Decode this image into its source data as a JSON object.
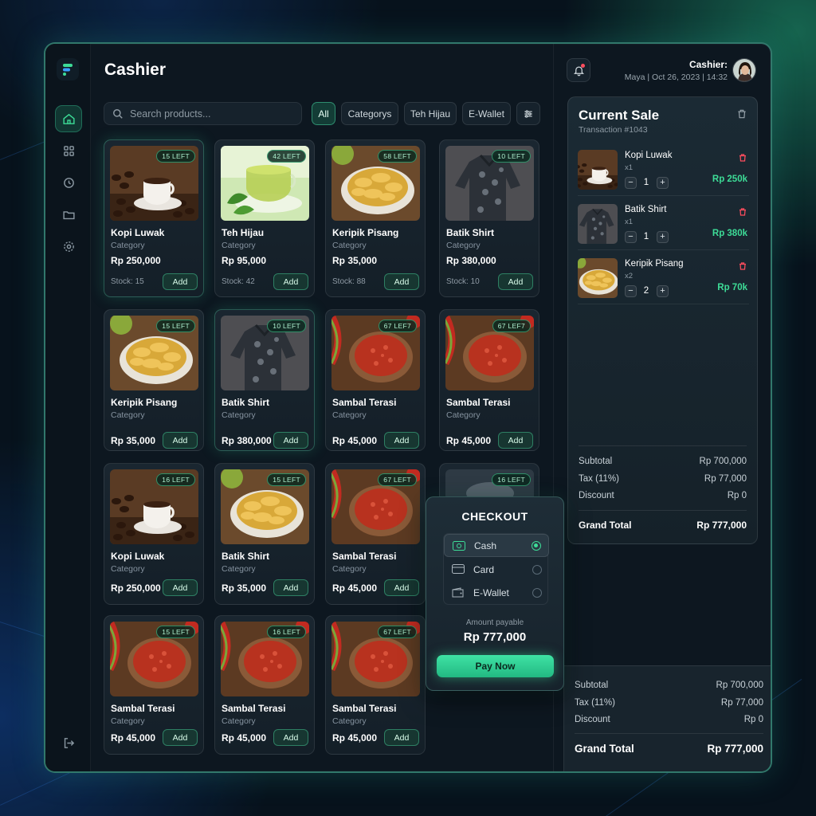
{
  "app": {
    "title": "Cashier"
  },
  "search": {
    "placeholder": "Search products..."
  },
  "filters": [
    "All",
    "Categorys",
    "Teh Hijau",
    "E-Wallet"
  ],
  "header": {
    "cashier_label": "Cashier:",
    "meta": "Maya | Oct 26, 2023 | 14:32"
  },
  "products": [
    {
      "name": "Kopi Luwak",
      "category": "Category",
      "price": "Rp 250,000",
      "badge": "15 LEFT",
      "stock": "Stock: 15",
      "img": "coffee"
    },
    {
      "name": "Teh Hijau",
      "category": "Category",
      "price": "Rp 95,000",
      "badge": "42 LEFT",
      "stock": "Stock: 42",
      "img": "tea"
    },
    {
      "name": "Keripik Pisang",
      "category": "Category",
      "price": "Rp 35,000",
      "badge": "58 LEFT",
      "stock": "Stock: 88",
      "img": "chips"
    },
    {
      "name": "Batik Shirt",
      "category": "Category",
      "price": "Rp 380,000",
      "badge": "10 LEFT",
      "stock": "Stock: 10",
      "img": "shirt"
    },
    {
      "name": "Keripik Pisang",
      "category": "Category",
      "price": "Rp 35,000",
      "badge": "15 LEFT",
      "img": "chips"
    },
    {
      "name": "Batik Shirt",
      "category": "Category",
      "price": "Rp 380,000",
      "badge": "10 LEFT",
      "img": "shirt"
    },
    {
      "name": "Sambal Terasi",
      "category": "Category",
      "price": "Rp 45,000",
      "badge": "67 LEF7",
      "img": "sambal"
    },
    {
      "name": "Sambal Terasi",
      "category": "Category",
      "price": "Rp 45,000",
      "badge": "67 LEF7",
      "img": "sambal"
    },
    {
      "name": "Kopi Luwak",
      "category": "Category",
      "price": "Rp 250,000",
      "badge": "16 LEFT",
      "img": "coffee"
    },
    {
      "name": "Batik Shirt",
      "category": "Category",
      "price": "Rp 35,000",
      "badge": "15 LEFT",
      "img": "chips"
    },
    {
      "name": "Sambal Terasi",
      "category": "Category",
      "price": "Rp 45,000",
      "badge": "67 LEFT",
      "img": "sambal"
    },
    {
      "name": "",
      "category": "",
      "price": "",
      "badge": "16 LEFT",
      "img": "pot"
    },
    {
      "name": "Sambal Terasi",
      "category": "Category",
      "price": "Rp 45,000",
      "badge": "15 LEFT",
      "img": "sambal"
    },
    {
      "name": "Sambal Terasi",
      "category": "Category",
      "price": "Rp 45,000",
      "badge": "16 LEFT",
      "img": "sambal"
    },
    {
      "name": "Sambal Terasi",
      "category": "Category",
      "price": "Rp 45,000",
      "badge": "67 LEFT",
      "img": "sambal"
    }
  ],
  "add_label": "Add",
  "sale": {
    "title": "Current Sale",
    "transaction": "Transaction #1043",
    "items": [
      {
        "name": "Kopi Luwak",
        "qty_label": "x1",
        "qty": "1",
        "price": "Rp 250k",
        "img": "coffee"
      },
      {
        "name": "Batik Shirt",
        "qty_label": "x1",
        "qty": "1",
        "price": "Rp 380k",
        "img": "shirt"
      },
      {
        "name": "Keripik Pisang",
        "qty_label": "x2",
        "qty": "2",
        "price": "Rp 70k",
        "img": "chips"
      }
    ],
    "subtotal_label": "Subtotal",
    "subtotal": "Rp 700,000",
    "tax_label": "Tax (11%)",
    "tax": "Rp 77,000",
    "discount_label": "Discount",
    "discount": "Rp 0",
    "grand_label": "Grand Total",
    "grand": "Rp 777,000"
  },
  "bottom": {
    "subtotal_label": "Subtotal",
    "subtotal": "Rp 700,000",
    "tax_label": "Tax (11%)",
    "tax": "Rp 77,000",
    "discount_label": "Discount",
    "discount": "Rp 0",
    "grand_label": "Grand Total",
    "grand": "Rp 777,000"
  },
  "checkout": {
    "title": "CHECKOUT",
    "methods": [
      "Cash",
      "Card",
      "E-Wallet"
    ],
    "selected": "Cash",
    "amount_label": "Amount payable",
    "amount": "Rp 777,000",
    "pay_label": "Pay Now"
  },
  "colors": {
    "accent": "#3ddc97",
    "danger": "#ff4d5e",
    "background": "#0d1720"
  },
  "icons": [
    "home-icon",
    "grid-icon",
    "clock-icon",
    "folder-icon",
    "settings-icon",
    "logout-icon",
    "bell-icon",
    "search-icon",
    "sliders-icon",
    "trash-icon",
    "cash-icon",
    "card-icon",
    "wallet-icon"
  ]
}
